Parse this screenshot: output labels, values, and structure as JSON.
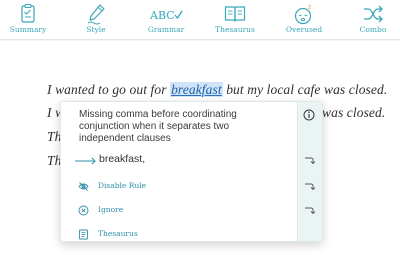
{
  "toolbar": {
    "items": [
      {
        "label": "Summary",
        "icon": "clipboard-icon"
      },
      {
        "label": "Style",
        "icon": "pencil-icon"
      },
      {
        "label": "Grammar",
        "icon": "abc-check-icon"
      },
      {
        "label": "Thesaurus",
        "icon": "book-icon"
      },
      {
        "label": "Overused",
        "icon": "sleepy-face-icon"
      },
      {
        "label": "Combo",
        "icon": "shuffle-icon"
      }
    ],
    "grammar_icon_text": "ABC",
    "overused_icon_text": "z"
  },
  "editor": {
    "lines": [
      {
        "before": "I wanted to go out for ",
        "highlight": "breakfast",
        "after": " but my local cafe was closed."
      },
      {
        "start": "I w",
        "end": "was closed."
      },
      {
        "start": "Th"
      },
      {
        "start": "Th"
      }
    ]
  },
  "popup": {
    "message": "Missing comma before coordinating conjunction when it separates two independent clauses",
    "suggestion": "breakfast,",
    "actions": [
      {
        "label": "Disable Rule",
        "icon": "eye-slash-icon"
      },
      {
        "label": "Ignore",
        "icon": "x-circle-icon"
      },
      {
        "label": "Thesaurus",
        "icon": "book-page-icon"
      }
    ]
  },
  "colors": {
    "accent": "#3aa7b8",
    "highlight_bg": "#cfe4f7",
    "highlight_text": "#1f5fa8",
    "popup_side": "#eaf4f5"
  }
}
